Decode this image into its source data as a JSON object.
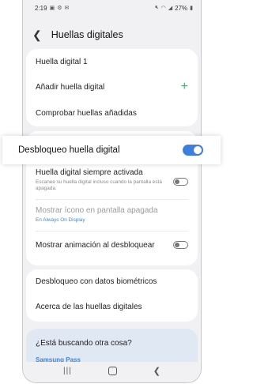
{
  "status_bar": {
    "time": "2:19",
    "left_icons": [
      "image-icon",
      "gear-icon",
      "email-icon"
    ],
    "battery": "27%",
    "right_icons": [
      "mute-icon",
      "wifi-icon",
      "signal-icon",
      "battery-icon"
    ]
  },
  "header": {
    "title": "Huellas digitales",
    "back_icon": "back-arrow-icon"
  },
  "fingerprints": {
    "items": [
      {
        "label": "Huella digital 1"
      },
      {
        "label": "Añadir huella digital",
        "icon": "plus-icon"
      },
      {
        "label": "Comprobar huellas añadidas"
      }
    ]
  },
  "unlock": {
    "label": "Desbloqueo huella digital",
    "enabled": true
  },
  "settings": {
    "always_on": {
      "label": "Huella digital siempre activada",
      "description": "Escanee su huella digital incluso cuando la pantalla está apagada.",
      "enabled": false
    },
    "screen_off_icon": {
      "label": "Mostrar ícono en pantalla apagada",
      "sublabel": "En Always On Display"
    },
    "unlock_animation": {
      "label": "Mostrar animación al desbloquear",
      "enabled": false
    }
  },
  "more": {
    "items": [
      {
        "label": "Desbloqueo con datos biométricos"
      },
      {
        "label": "Acerca de las huellas digitales"
      }
    ]
  },
  "suggestions": {
    "title": "¿Está buscando otra cosa?",
    "link": "Samsung Pass"
  },
  "colors": {
    "accent": "#3c7fe0",
    "add_icon": "#3fae6a",
    "background": "#f1f1f3"
  }
}
